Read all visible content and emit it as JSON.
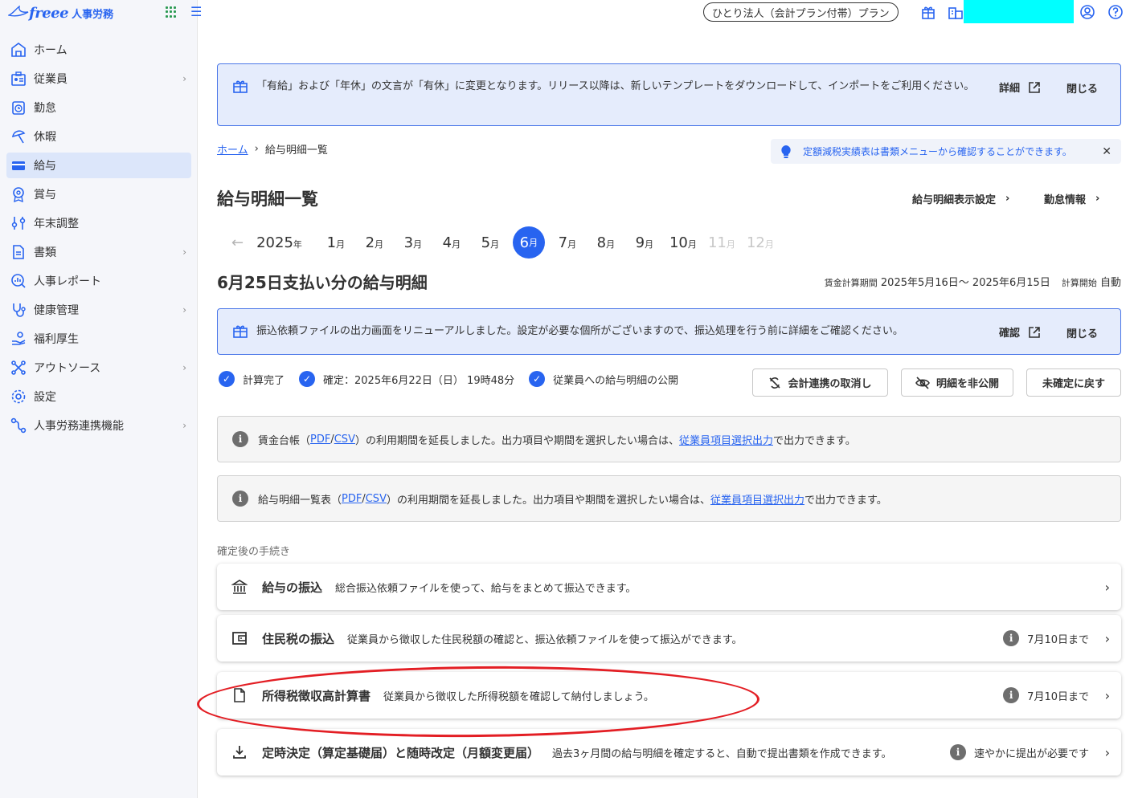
{
  "sidebar": {
    "logo_text": "freee",
    "logo_sub": "人事労務",
    "items": [
      {
        "label": "ホーム",
        "icon": "home-icon",
        "chevron": false
      },
      {
        "label": "従業員",
        "icon": "employee-icon",
        "chevron": true
      },
      {
        "label": "勤怠",
        "icon": "attendance-icon",
        "chevron": false
      },
      {
        "label": "休暇",
        "icon": "vacation-icon",
        "chevron": false
      },
      {
        "label": "給与",
        "icon": "payroll-icon",
        "chevron": false,
        "active": true
      },
      {
        "label": "賞与",
        "icon": "bonus-icon",
        "chevron": false
      },
      {
        "label": "年末調整",
        "icon": "year-end-icon",
        "chevron": false
      },
      {
        "label": "書類",
        "icon": "document-icon",
        "chevron": true
      },
      {
        "label": "人事レポート",
        "icon": "report-icon",
        "chevron": false
      },
      {
        "label": "健康管理",
        "icon": "health-icon",
        "chevron": true
      },
      {
        "label": "福利厚生",
        "icon": "welfare-icon",
        "chevron": false
      },
      {
        "label": "アウトソース",
        "icon": "outsource-icon",
        "chevron": true
      },
      {
        "label": "設定",
        "icon": "gear-icon",
        "chevron": false
      },
      {
        "label": "人事労務連携機能",
        "icon": "integration-icon",
        "chevron": true
      }
    ]
  },
  "topbar": {
    "plan": "ひとり法人（会計プラン付帯）プラン"
  },
  "banner1": {
    "text": "「有給」および「年休」の文言が「有休」に変更となります。リリース以降は、新しいテンプレートをダウンロードして、インポートをご利用ください。",
    "link": "詳細",
    "close": "閉じる"
  },
  "breadcrumb": {
    "home": "ホーム",
    "current": "給与明細一覧"
  },
  "tip": {
    "text": "定額減税実績表は書類メニューから確認することができます。"
  },
  "page": {
    "title": "給与明細一覧",
    "link_settings": "給与明細表示設定",
    "link_attendance": "勤怠情報"
  },
  "months": {
    "year": "2025",
    "year_unit": "年",
    "unit": "月",
    "list": [
      {
        "n": "1"
      },
      {
        "n": "2"
      },
      {
        "n": "3"
      },
      {
        "n": "4"
      },
      {
        "n": "5"
      },
      {
        "n": "6",
        "selected": true
      },
      {
        "n": "7"
      },
      {
        "n": "8"
      },
      {
        "n": "9"
      },
      {
        "n": "10"
      },
      {
        "n": "11",
        "disabled": true
      },
      {
        "n": "12",
        "disabled": true
      }
    ]
  },
  "payslip": {
    "title": "6月25日支払い分の給与明細",
    "period_label": "賃金計算期間",
    "period_value": "2025年5月16日～ 2025年6月15日",
    "start_label": "計算開始",
    "start_value": "自動"
  },
  "banner2": {
    "text": "振込依頼ファイルの出力画面をリニューアルしました。設定が必要な個所がございますので、振込処理を行う前に詳細をご確認ください。",
    "link": "確認",
    "close": "閉じる"
  },
  "status": {
    "s1": "計算完了",
    "s2": "確定：2025年6月22日（日） 19時48分",
    "s3": "従業員への給与明細の公開"
  },
  "buttons": {
    "unlink": "会計連携の取消し",
    "hide": "明細を非公開",
    "revert": "未確定に戻す"
  },
  "info1": {
    "pre": "賃金台帳（",
    "pdf": "PDF",
    "slash": "/",
    "csv": "CSV",
    "mid": "）の利用期間を延長しました。出力項目や期間を選択したい場合は、",
    "link": "従業員項目選択出力",
    "post": "で出力できます。"
  },
  "info2": {
    "pre": "給与明細一覧表（",
    "pdf": "PDF",
    "slash": "/",
    "csv": "CSV",
    "mid": "）の利用期間を延長しました。出力項目や期間を選択したい場合は、",
    "link": "従業員項目選択出力",
    "post": "で出力できます。"
  },
  "section_label": "確定後の手続き",
  "cards": [
    {
      "title": "給与の振込",
      "desc": "総合振込依頼ファイルを使って、給与をまとめて振込できます。",
      "right": ""
    },
    {
      "title": "住民税の振込",
      "desc": "従業員から徴収した住民税額の確認と、振込依頼ファイルを使って振込ができます。",
      "right": "7月10日まで"
    },
    {
      "title": "所得税徴収高計算書",
      "desc": "従業員から徴収した所得税額を確認して納付しましょう。",
      "right": "7月10日まで"
    },
    {
      "title": "定時決定（算定基礎届）と随時改定（月額変更届）",
      "desc": "過去3ヶ月間の給与明細を確定すると、自動で提出書類を作成できます。",
      "right": "速やかに提出が必要です"
    }
  ],
  "colors": {
    "accent": "#2864f0",
    "banner_bg": "#e5ecfc",
    "annotation": "#e31e24"
  }
}
